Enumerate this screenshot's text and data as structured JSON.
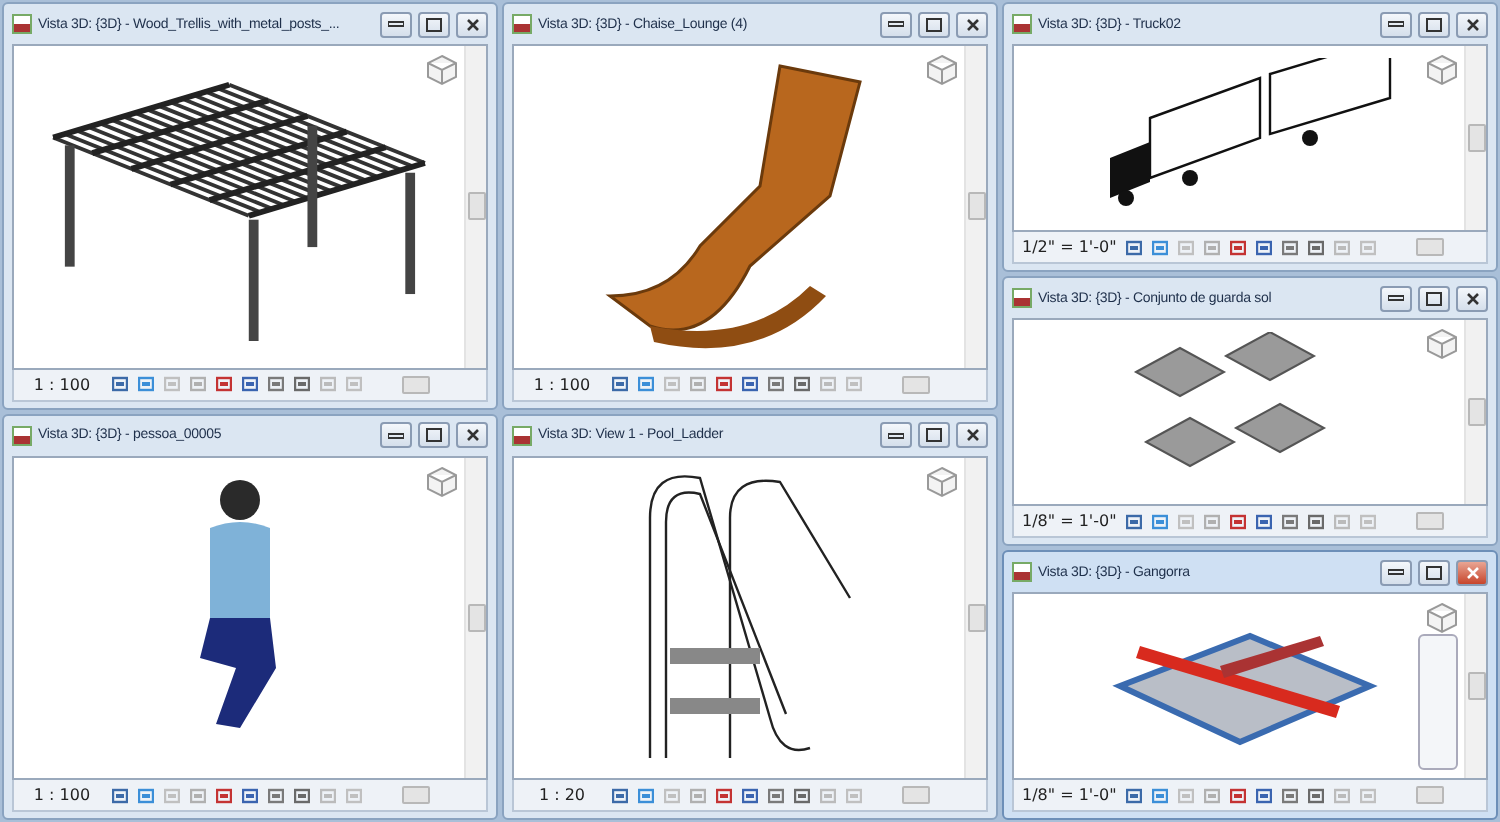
{
  "columns": [
    {
      "windows": [
        {
          "title": "Vista 3D: {3D} - Wood_Trellis_with_metal_posts_...",
          "scale": "1 : 100",
          "kind": "trellis",
          "selected": false,
          "nav_bar": false
        },
        {
          "title": "Vista 3D: {3D} - pessoa_00005",
          "scale": "1 : 100",
          "kind": "person",
          "selected": false,
          "nav_bar": false
        }
      ]
    },
    {
      "windows": [
        {
          "title": "Vista 3D: {3D} - Chaise_Lounge (4)",
          "scale": "1 : 100",
          "kind": "lounge",
          "selected": false,
          "nav_bar": false
        },
        {
          "title": "Vista 3D: View 1 - Pool_Ladder",
          "scale": "1 : 20",
          "kind": "ladder",
          "selected": false,
          "nav_bar": false
        }
      ]
    },
    {
      "windows": [
        {
          "title": "Vista 3D: {3D} - Truck02",
          "scale": "1/2\" = 1'-0\"",
          "kind": "truck",
          "selected": false,
          "nav_bar": false
        },
        {
          "title": "Vista 3D: {3D} - Conjunto de guarda sol",
          "scale": "1/8\" = 1'-0\"",
          "kind": "umbrellas",
          "selected": false,
          "nav_bar": false
        },
        {
          "title": "Vista 3D: {3D} - Gangorra",
          "scale": "1/8\" = 1'-0\"",
          "kind": "seesaw",
          "selected": true,
          "nav_bar": true
        }
      ]
    }
  ]
}
